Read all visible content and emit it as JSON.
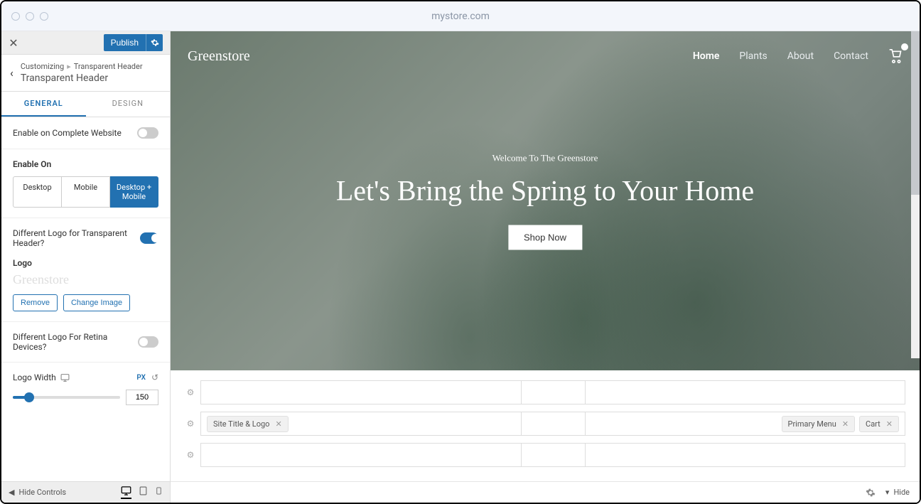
{
  "titlebar": {
    "url": "mystore.com"
  },
  "sidebar": {
    "publish_label": "Publish",
    "breadcrumb": {
      "root": "Customizing",
      "current": "Transparent Header"
    },
    "section_title": "Transparent Header",
    "tabs": {
      "general": "GENERAL",
      "design": "DESIGN"
    },
    "enable_complete": {
      "label": "Enable on Complete Website",
      "on": false
    },
    "enable_on": {
      "heading": "Enable On",
      "options": [
        "Desktop",
        "Mobile",
        "Desktop + Mobile"
      ],
      "selected": 2
    },
    "diff_logo": {
      "label": "Different Logo for Transparent Header?",
      "on": true
    },
    "logo_heading": "Logo",
    "logo_preview_text": "Greenstore",
    "remove_btn": "Remove",
    "change_btn": "Change Image",
    "retina": {
      "label": "Different Logo For Retina Devices?",
      "on": false
    },
    "logo_width": {
      "label": "Logo Width",
      "unit": "PX",
      "value": "150"
    },
    "hide_controls": "Hide Controls"
  },
  "preview": {
    "site_title": "Greenstore",
    "nav": [
      "Home",
      "Plants",
      "About",
      "Contact"
    ],
    "nav_active": 0,
    "hero_welcome": "Welcome To The Greenstore",
    "hero_title": "Let's Bring the Spring to Your Home",
    "shop_btn": "Shop Now",
    "builder": {
      "chip_site_title": "Site Title & Logo",
      "chip_primary_menu": "Primary Menu",
      "chip_cart": "Cart"
    },
    "hide_label": "Hide"
  }
}
